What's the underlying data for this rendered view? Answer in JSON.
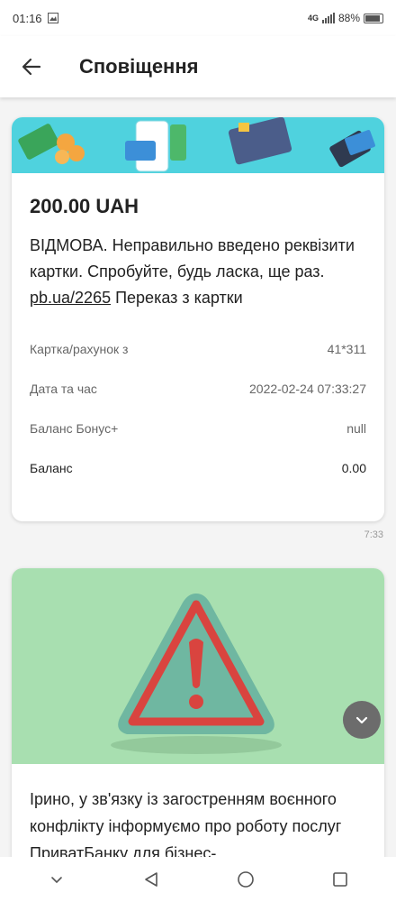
{
  "status": {
    "time": "01:16",
    "network": "4G",
    "battery": "88%"
  },
  "header": {
    "title": "Сповіщення"
  },
  "card1": {
    "amount": "200.00 UAH",
    "message_part1": "ВІДМОВА. Неправильно введено реквізити картки. Спробуйте, будь ласка, ще раз. ",
    "message_link": "pb.ua/2265",
    "message_part2": "  Переказ з картки",
    "details": [
      {
        "label": "Картка/рахунок з",
        "value": "41*311"
      },
      {
        "label": "Дата та час",
        "value": "2022-02-24 07:33:27"
      },
      {
        "label": "Баланс Бонус+",
        "value": "null"
      },
      {
        "label": "Баланс",
        "value": "0.00"
      }
    ],
    "time": "7:33"
  },
  "card2": {
    "message": "Ірино, у зв'язку із загостренням воєнного конфлікту інформуємо про роботу послуг ПриватБанку для бізнес-"
  },
  "colors": {
    "banner1": "#4fd2de",
    "banner2": "#a8dfb0",
    "warning_red": "#d9443f",
    "warning_green": "#6fb7a1"
  },
  "icons": {
    "back": "arrow-left-icon",
    "fab": "chevron-down-icon",
    "nav": [
      "chevron-down-icon",
      "back-triangle-icon",
      "home-circle-icon",
      "recents-square-icon"
    ]
  }
}
